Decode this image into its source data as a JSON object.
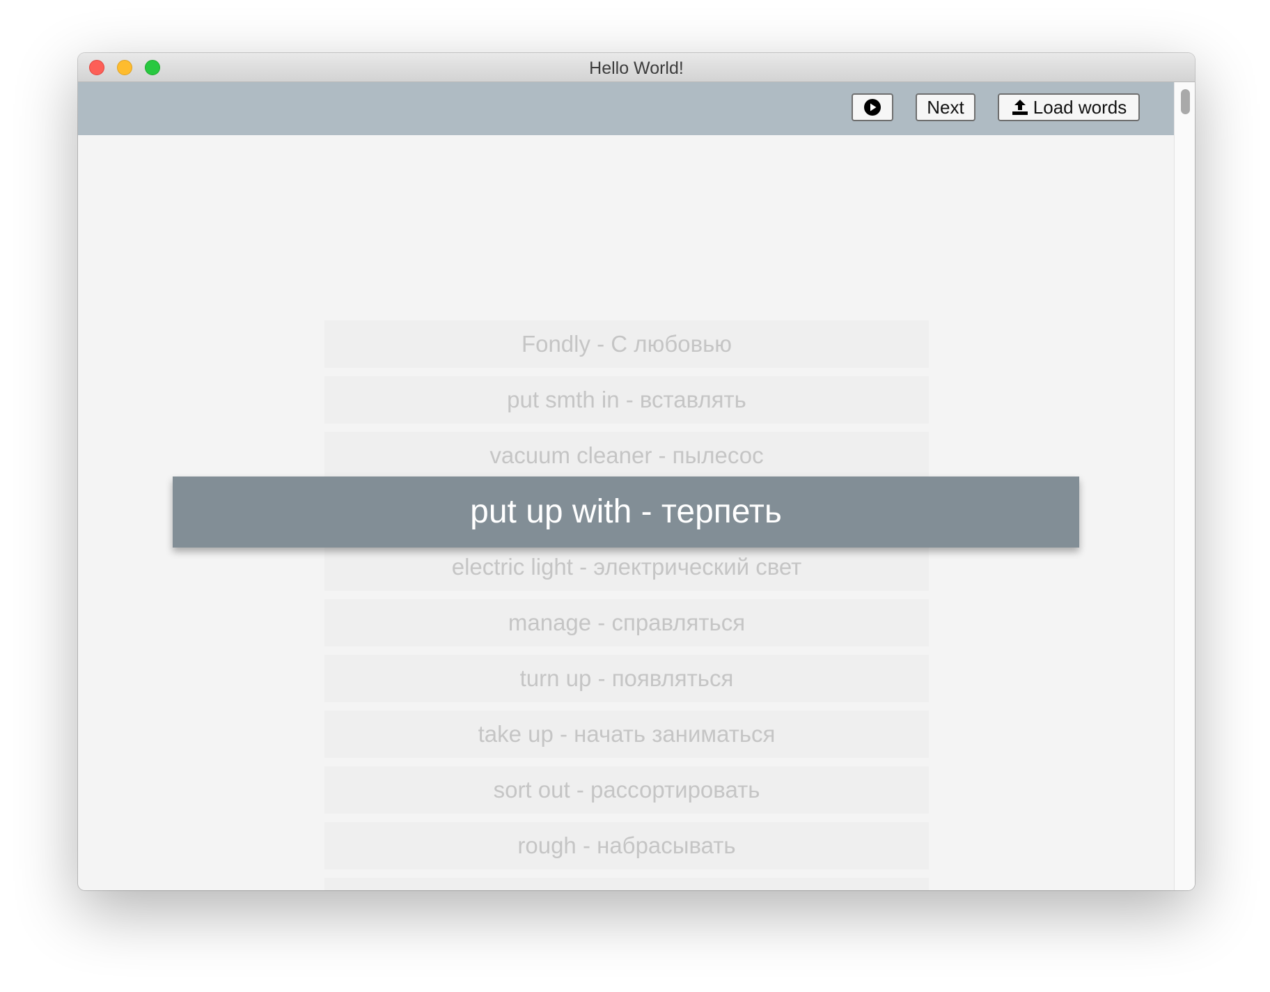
{
  "window": {
    "title": "Hello World!"
  },
  "toolbar": {
    "play_icon": "play-circle-icon",
    "next_label": "Next",
    "load_icon": "upload-icon",
    "load_label": "Load words",
    "background": "#afbbc3"
  },
  "words": {
    "items": [
      "Fondly - С любовью",
      "put smth in - вставлять",
      "vacuum cleaner - пылесос",
      "",
      "electric light - электрический свет",
      "manage - справляться",
      "turn up - появляться",
      "take up - начать заниматься",
      "sort out - рассортировать",
      "rough - набрасывать",
      ""
    ],
    "current": "put up with - терпеть",
    "current_background": "#828e96"
  }
}
